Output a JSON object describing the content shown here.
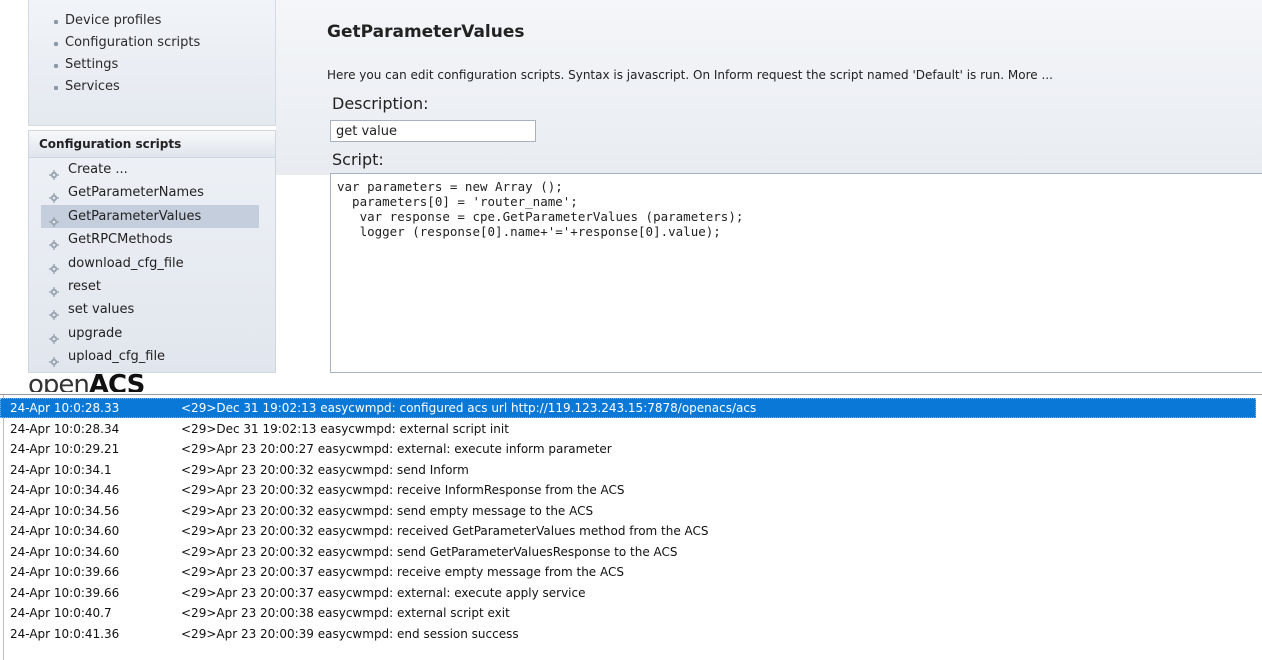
{
  "nav": {
    "items": [
      "Device profiles",
      "Configuration scripts",
      "Settings",
      "Services"
    ]
  },
  "scripts_panel": {
    "header": "Configuration scripts",
    "items": [
      {
        "label": "Create ...",
        "selected": false
      },
      {
        "label": "GetParameterNames",
        "selected": false
      },
      {
        "label": "GetParameterValues",
        "selected": true
      },
      {
        "label": "GetRPCMethods",
        "selected": false
      },
      {
        "label": "download_cfg_file",
        "selected": false
      },
      {
        "label": "reset",
        "selected": false
      },
      {
        "label": "set values",
        "selected": false
      },
      {
        "label": "upgrade",
        "selected": false
      },
      {
        "label": "upload_cfg_file",
        "selected": false
      }
    ]
  },
  "logo": {
    "prefix": "open",
    "brand": "ACS"
  },
  "main": {
    "title": "GetParameterValues",
    "intro": "Here you can edit configuration scripts. Syntax is javascript. On Inform request the script named 'Default' is run. More ...",
    "description_label": "Description:",
    "description_value": "get value",
    "script_label": "Script:",
    "script_body": "var parameters = new Array ();\n  parameters[0] = 'router_name';\n   var response = cpe.GetParameterValues (parameters);\n   logger (response[0].name+'='+response[0].value);"
  },
  "log": {
    "rows": [
      {
        "time": "24-Apr 10:0:28.33",
        "message": "<29>Dec 31 19:02:13 easycwmpd: configured acs url http://119.123.243.15:7878/openacs/acs",
        "selected": true
      },
      {
        "time": "24-Apr 10:0:28.34",
        "message": "<29>Dec 31 19:02:13 easycwmpd: external script init",
        "selected": false
      },
      {
        "time": "24-Apr 10:0:29.21",
        "message": "<29>Apr 23 20:00:27 easycwmpd: external: execute inform parameter",
        "selected": false
      },
      {
        "time": "24-Apr 10:0:34.1",
        "message": "<29>Apr 23 20:00:32 easycwmpd: send Inform",
        "selected": false
      },
      {
        "time": "24-Apr 10:0:34.46",
        "message": "<29>Apr 23 20:00:32 easycwmpd: receive InformResponse from the ACS",
        "selected": false
      },
      {
        "time": "24-Apr 10:0:34.56",
        "message": "<29>Apr 23 20:00:32 easycwmpd: send empty message to the ACS",
        "selected": false
      },
      {
        "time": "24-Apr 10:0:34.60",
        "message": "<29>Apr 23 20:00:32 easycwmpd: received GetParameterValues method from the ACS",
        "selected": false
      },
      {
        "time": "24-Apr 10:0:34.60",
        "message": "<29>Apr 23 20:00:32 easycwmpd: send GetParameterValuesResponse to the ACS",
        "selected": false
      },
      {
        "time": "24-Apr 10:0:39.66",
        "message": "<29>Apr 23 20:00:37 easycwmpd: receive empty message from the ACS",
        "selected": false
      },
      {
        "time": "24-Apr 10:0:39.66",
        "message": "<29>Apr 23 20:00:37 easycwmpd: external: execute apply service",
        "selected": false
      },
      {
        "time": "24-Apr 10:0:40.7",
        "message": "<29>Apr 23 20:00:38 easycwmpd: external script exit",
        "selected": false
      },
      {
        "time": "24-Apr 10:0:41.36",
        "message": "<29>Apr 23 20:00:39 easycwmpd: end session success",
        "selected": false
      }
    ]
  },
  "colors": {
    "selection": "#0a78d7",
    "panel_selection": "#c4cedc"
  },
  "icons": {
    "script_item": "gear-icon",
    "nav_item": "bullet-icon"
  }
}
